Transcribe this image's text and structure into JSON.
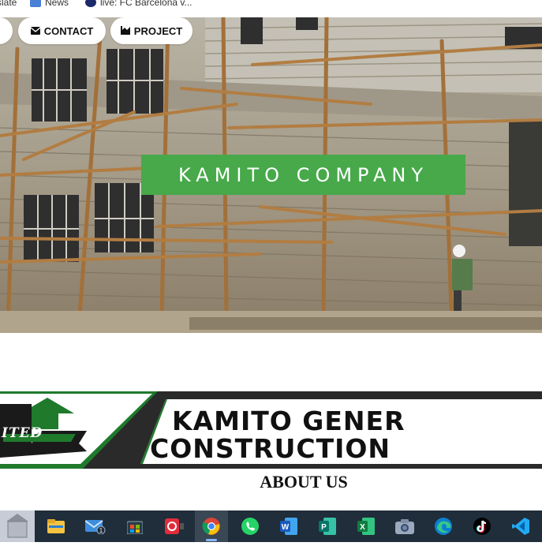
{
  "bookmarks": [
    {
      "label": "slate",
      "icon": "translate-icon"
    },
    {
      "label": "News",
      "icon": "news-icon"
    },
    {
      "label": "live: FC Barcelona v...",
      "icon": "live-icon"
    }
  ],
  "nav": {
    "contact_label": "CONTACT",
    "project_label": "PROJECT"
  },
  "hero": {
    "title": "KAMITO COMPANY"
  },
  "banner": {
    "line1": "KAMITO GENER",
    "line2": "CONSTRUCTION",
    "logo_text": "ITED"
  },
  "about": {
    "heading": "ABOUT US"
  },
  "colors": {
    "accent_green": "#47a94a",
    "banner_dark": "#2a2a2a",
    "taskbar": "#202d3a"
  },
  "taskbar": {
    "items": [
      {
        "name": "file-explorer-icon"
      },
      {
        "name": "mail-icon",
        "badge": "1"
      },
      {
        "name": "microsoft-store-icon"
      },
      {
        "name": "media-app-icon"
      },
      {
        "name": "chrome-icon",
        "active": true
      },
      {
        "name": "whatsapp-icon"
      },
      {
        "name": "word-icon"
      },
      {
        "name": "publisher-icon"
      },
      {
        "name": "excel-icon"
      },
      {
        "name": "camera-icon"
      },
      {
        "name": "edge-icon"
      },
      {
        "name": "tiktok-icon"
      },
      {
        "name": "vscode-icon"
      }
    ]
  }
}
